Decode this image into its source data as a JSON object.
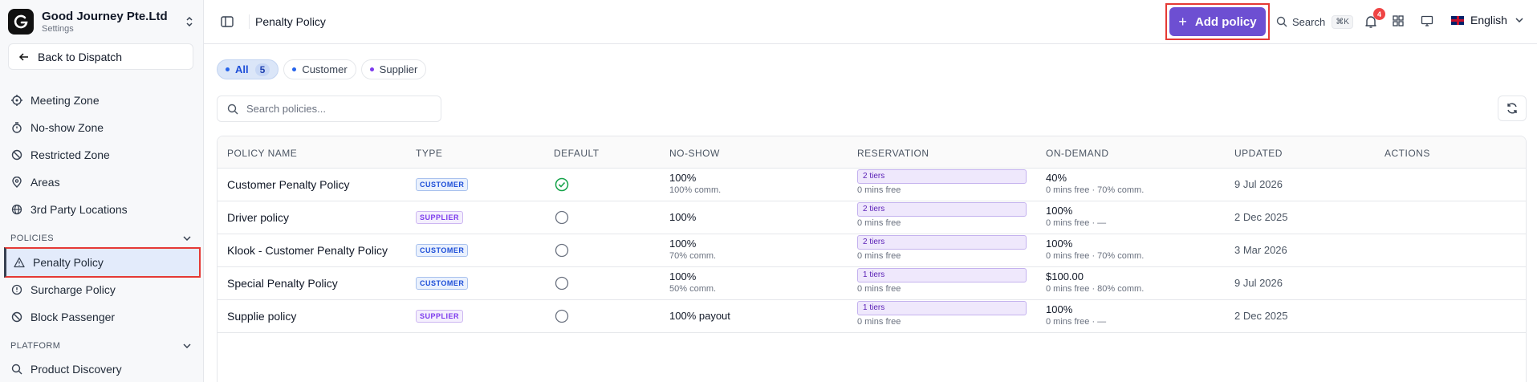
{
  "org": {
    "name": "Good Journey Pte.Ltd",
    "subtitle": "Settings"
  },
  "sidebar": {
    "back_label": "Back to Dispatch",
    "items_top": [
      {
        "label": "Meeting Zone",
        "icon": "target-icon"
      },
      {
        "label": "No-show Zone",
        "icon": "timer-icon"
      },
      {
        "label": "Restricted Zone",
        "icon": "ban-icon"
      },
      {
        "label": "Areas",
        "icon": "map-pin-icon"
      },
      {
        "label": "3rd Party Locations",
        "icon": "globe-icon"
      }
    ],
    "section_policies": "POLICIES",
    "items_policies": [
      {
        "label": "Penalty Policy",
        "icon": "warning-icon",
        "active": true
      },
      {
        "label": "Surcharge Policy",
        "icon": "alert-circle-icon"
      },
      {
        "label": "Block Passenger",
        "icon": "ban-icon"
      }
    ],
    "section_platform": "PLATFORM",
    "items_platform": [
      {
        "label": "Product Discovery",
        "icon": "search-icon"
      }
    ]
  },
  "header": {
    "page_title": "Penalty Policy",
    "add_label": "Add policy",
    "search_label": "Search",
    "search_kbd": "⌘K",
    "notification_count": "4",
    "language": "English"
  },
  "filters": [
    {
      "label": "All",
      "count": "5",
      "active": true,
      "dot_color": "#2563eb"
    },
    {
      "label": "Customer",
      "dot_color": "#2563eb"
    },
    {
      "label": "Supplier",
      "dot_color": "#7c3aed"
    }
  ],
  "search": {
    "placeholder": "Search policies..."
  },
  "table": {
    "columns": [
      "POLICY NAME",
      "TYPE",
      "DEFAULT",
      "NO-SHOW",
      "RESERVATION",
      "ON-DEMAND",
      "UPDATED",
      "ACTIONS"
    ],
    "rows": [
      {
        "name": "Customer Penalty Policy",
        "type": "CUSTOMER",
        "default": true,
        "noshow": "100%",
        "noshow_sub": "100% comm.",
        "tiers": "2 tiers",
        "res_sub": "0 mins free",
        "ondemand": "40%",
        "ondemand_sub": "0 mins free · 70% comm.",
        "updated": "9 Jul 2026"
      },
      {
        "name": "Driver policy",
        "type": "SUPPLIER",
        "default": false,
        "noshow": "100%",
        "noshow_sub": "",
        "tiers": "2 tiers",
        "res_sub": "0 mins free",
        "ondemand": "100%",
        "ondemand_sub": "0 mins free · —",
        "updated": "2 Dec 2025"
      },
      {
        "name": "Klook - Customer Penalty Policy",
        "type": "CUSTOMER",
        "default": false,
        "noshow": "100%",
        "noshow_sub": "70% comm.",
        "tiers": "2 tiers",
        "res_sub": "0 mins free",
        "ondemand": "100%",
        "ondemand_sub": "0 mins free · 70% comm.",
        "updated": "3 Mar 2026"
      },
      {
        "name": "Special Penalty Policy",
        "type": "CUSTOMER",
        "default": false,
        "noshow": "100%",
        "noshow_sub": "50% comm.",
        "tiers": "1 tiers",
        "res_sub": "0 mins free",
        "ondemand": "$100.00",
        "ondemand_sub": "0 mins free · 80% comm.",
        "updated": "9 Jul 2026"
      },
      {
        "name": "Supplie policy",
        "type": "SUPPLIER",
        "default": false,
        "noshow": "100% payout",
        "noshow_sub": "",
        "tiers": "1 tiers",
        "res_sub": "0 mins free",
        "ondemand": "100%",
        "ondemand_sub": "0 mins free · —",
        "updated": "2 Dec 2025"
      }
    ]
  }
}
